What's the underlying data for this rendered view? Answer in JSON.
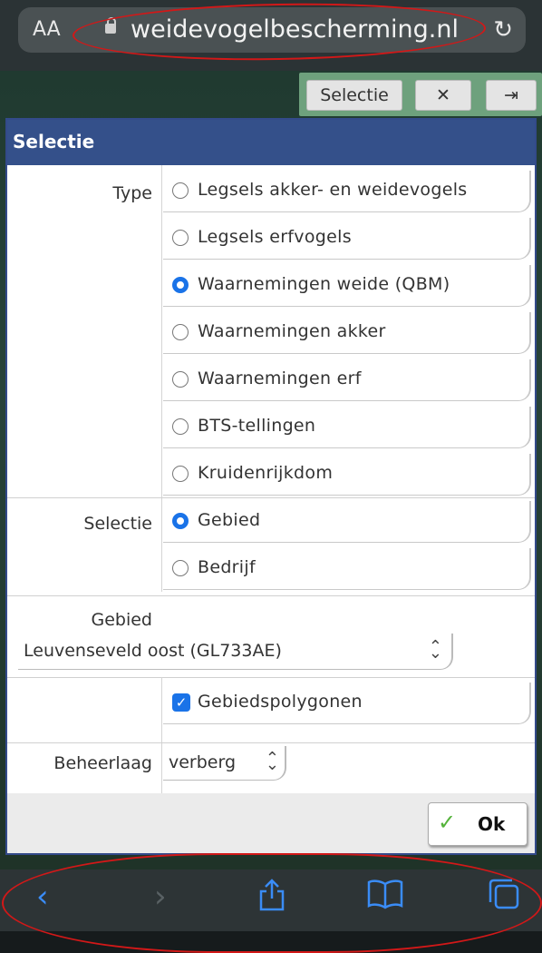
{
  "browser": {
    "text_size_label": "AA",
    "url": "weidevogelbescherming.nl",
    "reload_icon": "reload-icon"
  },
  "map_toolbar": {
    "selectie_label": "Selectie",
    "close_icon": "close-icon",
    "login_icon": "login-icon"
  },
  "dialog": {
    "title": "Selectie",
    "type_label": "Type",
    "type_options": [
      {
        "label": "Legsels akker- en weidevogels",
        "selected": false
      },
      {
        "label": "Legsels erfvogels",
        "selected": false
      },
      {
        "label": "Waarnemingen weide (QBM)",
        "selected": true
      },
      {
        "label": "Waarnemingen akker",
        "selected": false
      },
      {
        "label": "Waarnemingen erf",
        "selected": false
      },
      {
        "label": "BTS-tellingen",
        "selected": false
      },
      {
        "label": "Kruidenrijkdom",
        "selected": false
      }
    ],
    "selectie_label": "Selectie",
    "selectie_options": [
      {
        "label": "Gebied",
        "selected": true
      },
      {
        "label": "Bedrijf",
        "selected": false
      }
    ],
    "gebied_label": "Gebied",
    "gebied_value": "Leuvenseveld oost (GL733AE)",
    "polygon_label": "Gebiedspolygonen",
    "polygon_checked": true,
    "beheerlaag_label": "Beheerlaag",
    "beheerlaag_value": "verberg",
    "ok_label": "Ok"
  },
  "colors": {
    "accent_blue": "#1a73e8",
    "title_bar": "#34508a",
    "annotation_red": "#d21818",
    "ok_check": "#55b33b"
  }
}
